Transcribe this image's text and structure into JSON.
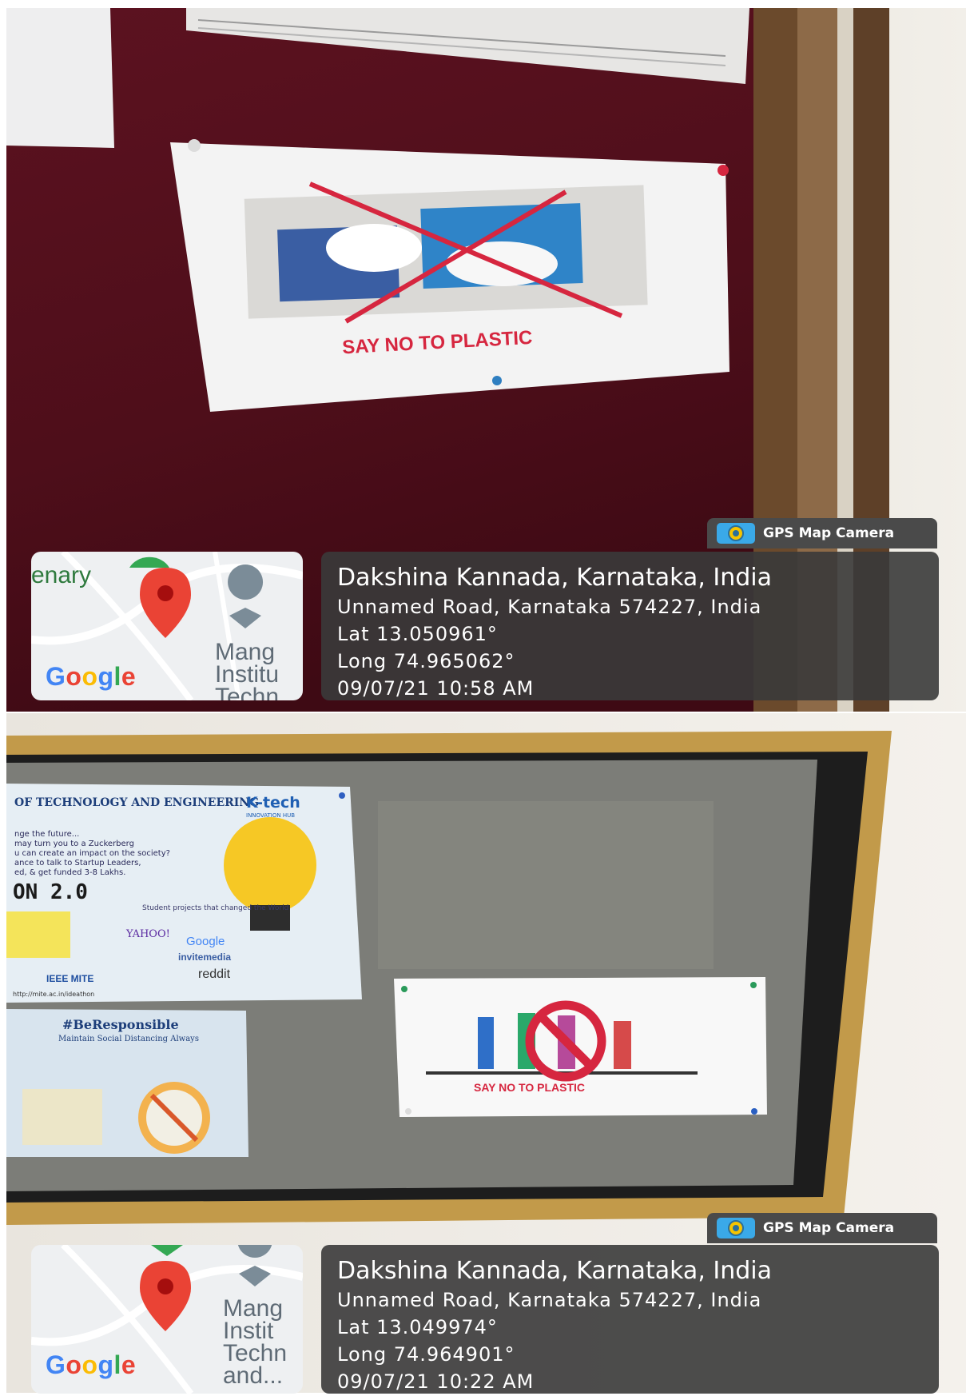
{
  "top": {
    "poster_text": "SAY NO TO PLASTIC",
    "badge": {
      "icon": "gps-map-camera-icon",
      "label": "GPS Map Camera"
    },
    "map": {
      "place_label": "enary",
      "institute_label": "Mang Institu Techn",
      "brand": "Google"
    },
    "info": {
      "location": "Dakshina Kannada, Karnataka, India",
      "address": "Unnamed Road, Karnataka 574227, India",
      "lat": "Lat 13.050961°",
      "long": "Long 74.965062°",
      "datetime": "09/07/21 10:58 AM"
    }
  },
  "bottom": {
    "poster_text": "SAY NO TO PLASTIC",
    "left_poster": {
      "header": "OF TECHNOLOGY AND ENGINEERING",
      "brand": "K-tech",
      "brand_sub": "INNOVATION HUB",
      "line1": "nge the future...",
      "line2": "may turn you to a Zuckerberg",
      "line3": "u can create an impact on the society?",
      "line4": "ance to talk to Startup Leaders,",
      "line5": "ed, & get funded 3-8 Lakhs.",
      "event": "ON 2.0",
      "side_text": "Student projects that changed the World",
      "yahoo": "YAHOO!",
      "google": "Google",
      "invitemedia": "invitemedia",
      "reddit": "reddit",
      "ieee": "IEEE MITE",
      "url": "http://mite.ac.in/ideathon"
    },
    "lower_poster": {
      "title": "#BeResponsible",
      "subtitle": "Maintain Social Distancing Always"
    },
    "badge": {
      "icon": "gps-map-camera-icon",
      "label": "GPS Map Camera"
    },
    "map": {
      "institute_label": "Mang Instit Techn and...",
      "brand": "Google"
    },
    "info": {
      "location": "Dakshina Kannada, Karnataka, India",
      "address": "Unnamed Road, Karnataka 574227, India",
      "lat": "Lat 13.049974°",
      "long": "Long 74.964901°",
      "datetime": "09/07/21 10:22 AM"
    }
  },
  "colors": {
    "board_red": "#5a0f1c",
    "frame_wood": "#b98a3a",
    "panel_gray": "#3a3a3a",
    "poster_red": "#d6263f"
  }
}
